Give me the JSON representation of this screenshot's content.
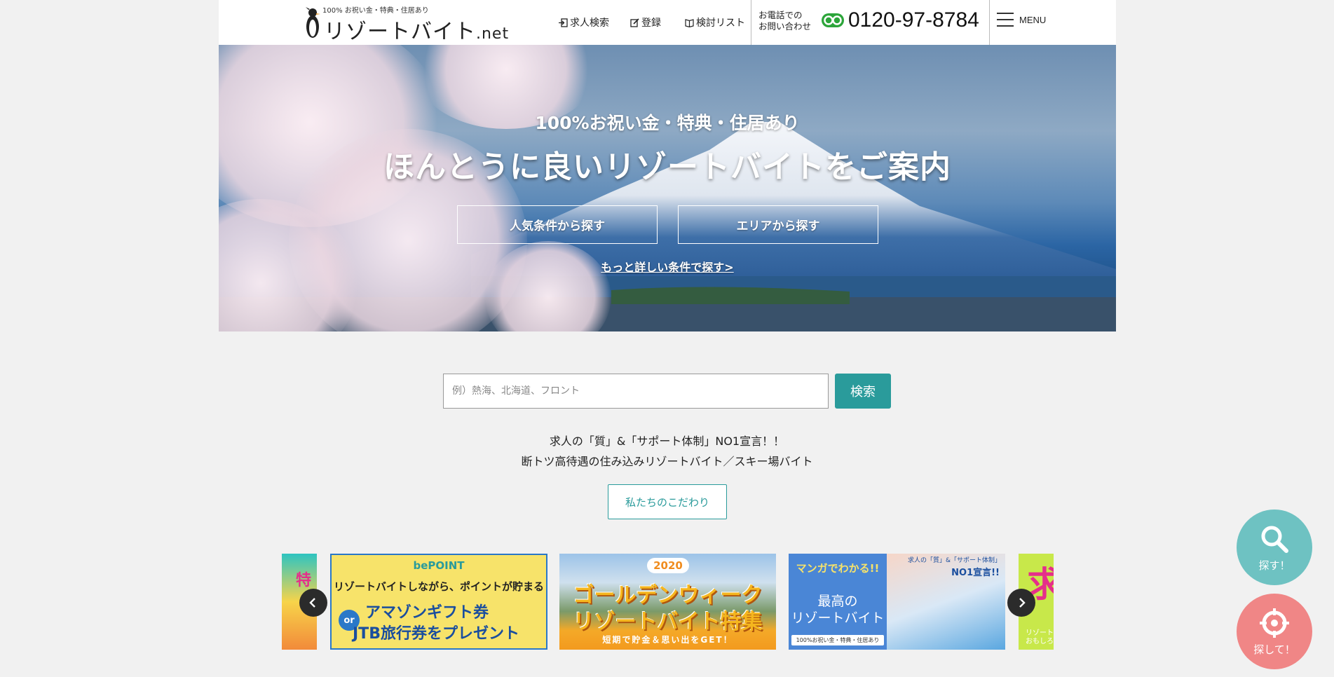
{
  "header": {
    "logo_tagline": "100% お祝い金・特典・住居あり",
    "logo_name": "リゾートバイト",
    "logo_suffix": ".net",
    "nav": {
      "job_search": "求人検索",
      "register": "登録",
      "favorites": "検討リスト"
    },
    "contact_label_line1": "お電話での",
    "contact_label_line2": "お問い合わせ",
    "phone_number": "0120-97-8784",
    "menu_label": "MENU"
  },
  "hero": {
    "subtitle": "100%お祝い金・特典・住居あり",
    "title": "ほんとうに良いリゾートバイトをご案内",
    "button_popular": "人気条件から探す",
    "button_area": "エリアから探す",
    "more_link": "もっと詳しい条件で探す>"
  },
  "search": {
    "placeholder": "例）熱海、北海道、フロント",
    "value": "",
    "button_label": "検索"
  },
  "tagline": {
    "line1": "求人の「質」&「サポート体制」NO1宣言！！",
    "line2": "断トツ高待遇の住み込みリゾートバイト／スキー場バイト"
  },
  "kodawari_button": "私たちのこだわり",
  "carousel": {
    "banner_point": {
      "logo": "bePOINT",
      "line1": "リゾートバイトしながら、ポイントが貯まる",
      "or": "or",
      "line2": "アマゾンギフト券",
      "line3": "JTB旅行券をプレゼント"
    },
    "banner_gw": {
      "year": "2020",
      "line1": "ゴールデンウィーク",
      "line2": "リゾートバイト特集",
      "line3": "短期で貯金＆思い出をGET！"
    },
    "banner_manga": {
      "line1": "マンガでわかる!!",
      "line2": "最高の",
      "line3": "リゾートバイト",
      "line4": "100%お祝い金・特典・住居あり",
      "right1": "求人の「質」&「サポート体制」",
      "right2": "NO1宣言!!"
    },
    "partial_left_text": "特",
    "partial_right_big": "求",
    "partial_right_small1": "リゾート",
    "partial_right_small2": "おもしろ",
    "prev_icon": "chevron-left-icon",
    "next_icon": "chevron-right-icon"
  },
  "floating": {
    "search_label": "探す！",
    "find_label": "探して！"
  },
  "colors": {
    "accent_teal": "#2a9b9b",
    "fab_teal": "#6ec2c2",
    "fab_pink": "#f08686"
  }
}
